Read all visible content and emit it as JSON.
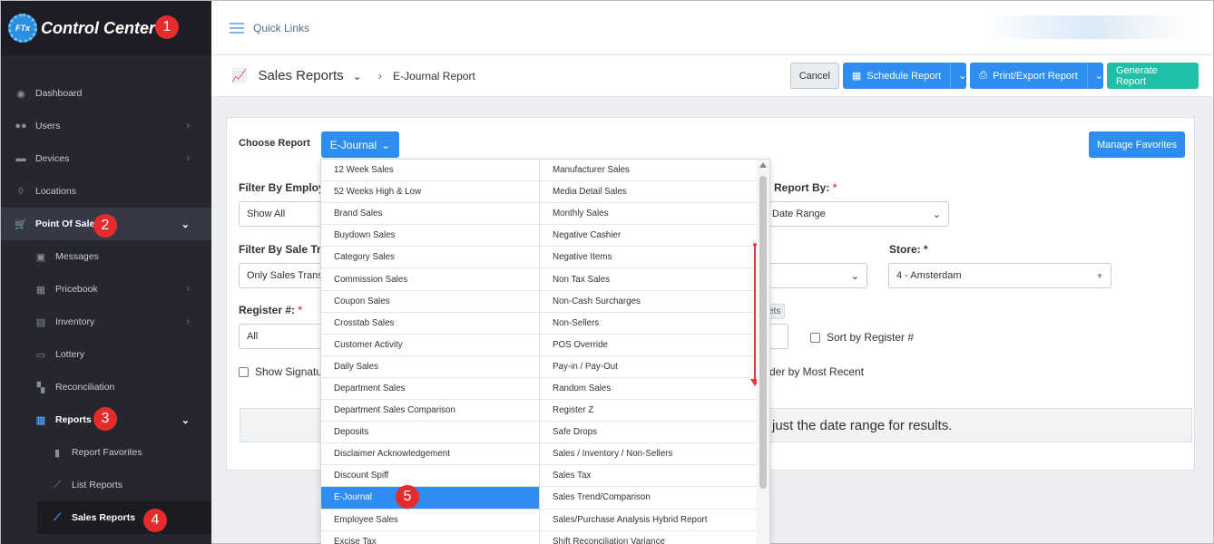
{
  "app": {
    "title": "Control Center",
    "logo_text": "FTx"
  },
  "sidebar": {
    "items": [
      {
        "label": "Dashboard",
        "icon": "palette-icon"
      },
      {
        "label": "Users",
        "icon": "users-icon"
      },
      {
        "label": "Devices",
        "icon": "devices-icon"
      },
      {
        "label": "Locations",
        "icon": "location-pin-icon"
      },
      {
        "label": "Point Of Sale",
        "icon": "cart-icon"
      },
      {
        "label": "Messages",
        "icon": "inbox-icon"
      },
      {
        "label": "Pricebook",
        "icon": "calculator-icon"
      },
      {
        "label": "Inventory",
        "icon": "inventory-icon"
      },
      {
        "label": "Lottery",
        "icon": "ticket-icon"
      },
      {
        "label": "Reconciliation",
        "icon": "grid-icon"
      },
      {
        "label": "Reports",
        "icon": "bar-chart-icon"
      },
      {
        "label": "Report Favorites",
        "icon": "bookmark-icon"
      },
      {
        "label": "List Reports",
        "icon": "line-chart-icon"
      },
      {
        "label": "Sales Reports",
        "icon": "line-chart-icon"
      }
    ]
  },
  "badges": [
    "1",
    "2",
    "3",
    "4",
    "5"
  ],
  "topbar": {
    "quick_links": "Quick Links"
  },
  "header": {
    "title": "Sales Reports",
    "breadcrumb": "E-Journal Report",
    "cancel": "Cancel",
    "schedule": "Schedule Report",
    "print_export": "Print/Export Report",
    "generate": "Generate Report"
  },
  "form": {
    "choose_report_label": "Choose Report",
    "choose_report_value": "E-Journal",
    "manage_favorites": "Manage Favorites",
    "filter_employee_label": "Filter By Employ",
    "filter_employee_value": "Show All",
    "report_by_label": "Report By:",
    "report_by_value": "Date Range",
    "filter_sale_label": "Filter By Sale Tra",
    "filter_sale_value": "Only Sales Trans",
    "store_label": "Store:",
    "store_value": "4 - Amsterdam",
    "register_label": "Register #:",
    "register_value": "All",
    "presets_tag": "ets",
    "sort_register": "Sort by Register #",
    "show_signature": "Show Signatu",
    "order_recent": "der by Most Recent",
    "info_text": "just the date range for results."
  },
  "dropdown": {
    "left": [
      "12 Week Sales",
      "52 Weeks High & Low",
      "Brand Sales",
      "Buydown Sales",
      "Category Sales",
      "Commission Sales",
      "Coupon Sales",
      "Crosstab Sales",
      "Customer Activity",
      "Daily Sales",
      "Department Sales",
      "Department Sales Comparison",
      "Deposits",
      "Disclaimer Acknowledgement",
      "Discount Spiff",
      "E-Journal",
      "Employee Sales",
      "Excise Tax"
    ],
    "right": [
      "Manufacturer Sales",
      "Media Detail Sales",
      "Monthly Sales",
      "Negative Cashier",
      "Negative Items",
      "Non Tax Sales",
      "Non-Cash Surcharges",
      "Non-Sellers",
      "POS Override",
      "Pay-in / Pay-Out",
      "Random Sales",
      "Register Z",
      "Safe Drops",
      "Sales / Inventory / Non-Sellers",
      "Sales Tax",
      "Sales Trend/Comparison",
      "Sales/Purchase Analysis Hybrid Report",
      "Shift Reconciliation Variance"
    ],
    "selected": "E-Journal"
  }
}
